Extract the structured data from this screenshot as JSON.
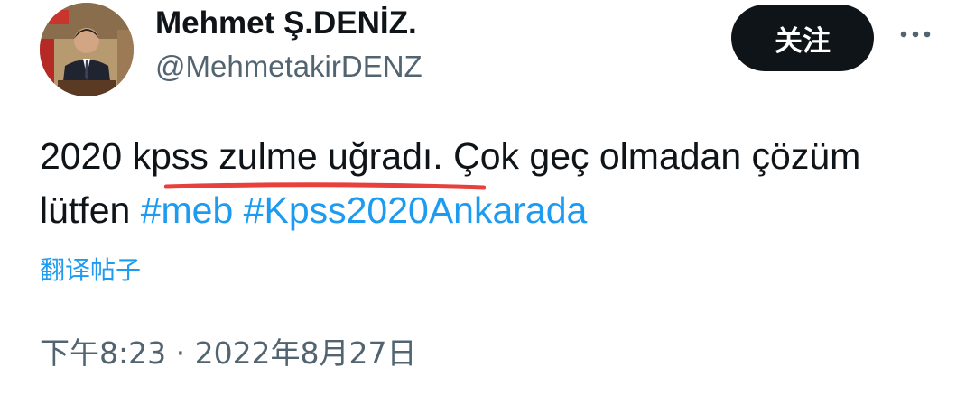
{
  "author": {
    "display_name": "Mehmet Ş.DENİZ.",
    "handle": "@MehmetakirDENZ"
  },
  "actions": {
    "follow_label": "关注",
    "more_icon": "more-horizontal-icon"
  },
  "tweet": {
    "text_part1": "2020 kpss zulme uğradı. Çok geç olmadan çözüm lütfen ",
    "hashtag1": "#meb",
    "hashtag2": "#Kpss2020Ankarada",
    "highlight_color": "#e8413c"
  },
  "translate_label": "翻译帖子",
  "timestamp": "下午8:23 · 2022年8月27日",
  "colors": {
    "link": "#1d9bf0",
    "text": "#0f1419",
    "secondary": "#536471"
  }
}
